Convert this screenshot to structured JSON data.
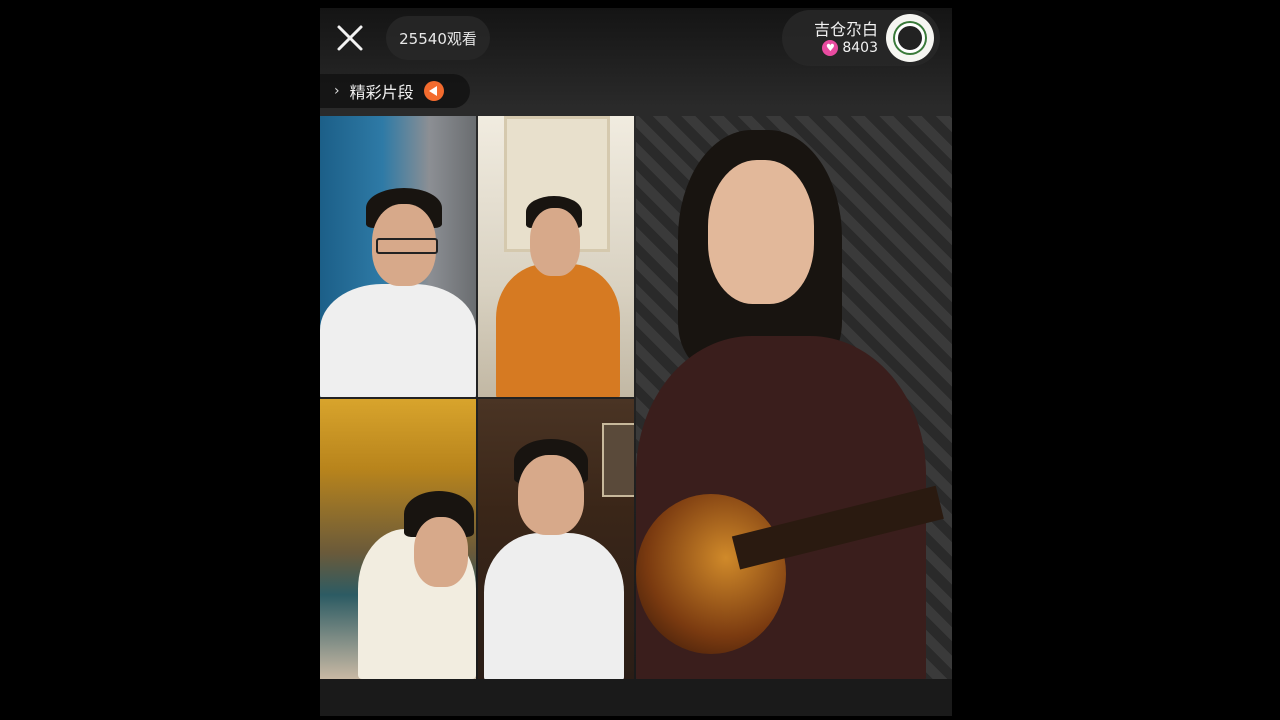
{
  "header": {
    "viewers": "25540观看",
    "host_name": "吉仓尕白",
    "host_likes": "8403"
  },
  "highlights": {
    "label": "精彩片段"
  },
  "icons": {
    "close": "close-icon",
    "heart": "heart-icon",
    "play": "play-icon",
    "chevron": "chevron-right-icon"
  },
  "colors": {
    "heart": "#e94ba0",
    "play": "#f36b2e"
  }
}
